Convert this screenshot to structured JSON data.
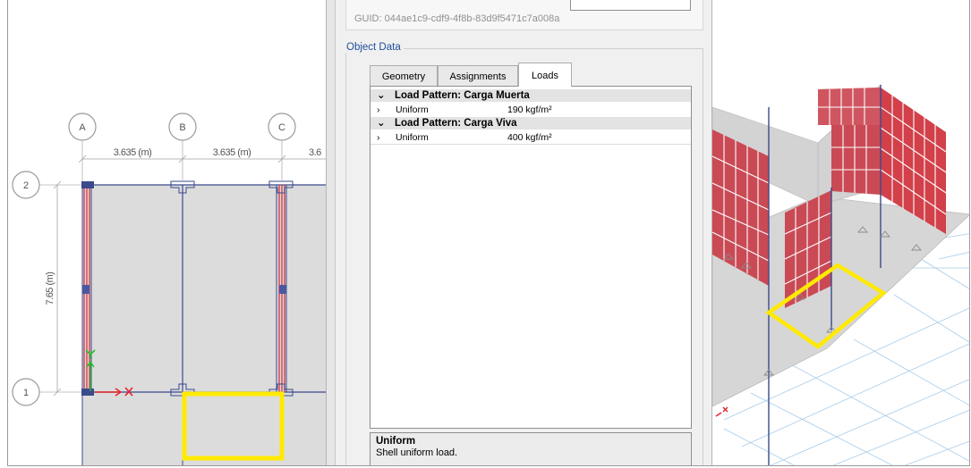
{
  "panel": {
    "guid_text": "GUID: 044ae1c9-cdf9-4f8b-83d9f5471c7a008a",
    "group_title": "Object Data",
    "tabs": [
      {
        "label": "Geometry",
        "active": false
      },
      {
        "label": "Assignments",
        "active": false
      },
      {
        "label": "Loads",
        "active": true
      }
    ],
    "load_patterns": [
      {
        "header": "Load Pattern: Carga Muerta",
        "item": "Uniform",
        "value": "190 kgf/m²"
      },
      {
        "header": "Load Pattern: Carga Viva",
        "item": "Uniform",
        "value": "400 kgf/m²"
      }
    ],
    "description": {
      "title": "Uniform",
      "text": "Shell uniform load."
    }
  },
  "plan": {
    "grid_x_labels": [
      "A",
      "B",
      "C"
    ],
    "grid_y_labels": [
      "2",
      "1"
    ],
    "dimension_x": [
      "3.635 (m)",
      "3.635 (m)",
      "3.6"
    ],
    "dimension_y": "7.65 (m)"
  },
  "icons": {
    "expand": "chevron-down-icon",
    "collapse": "chevron-right-icon"
  },
  "colors": {
    "selection": "#ffea00",
    "wall": "#d2404a",
    "slab": "#dcdcdc",
    "frame_line": "#3a4a8c",
    "axis_x": "#e8202a",
    "axis_y": "#22c42a",
    "group_title": "#1f4e9a"
  }
}
